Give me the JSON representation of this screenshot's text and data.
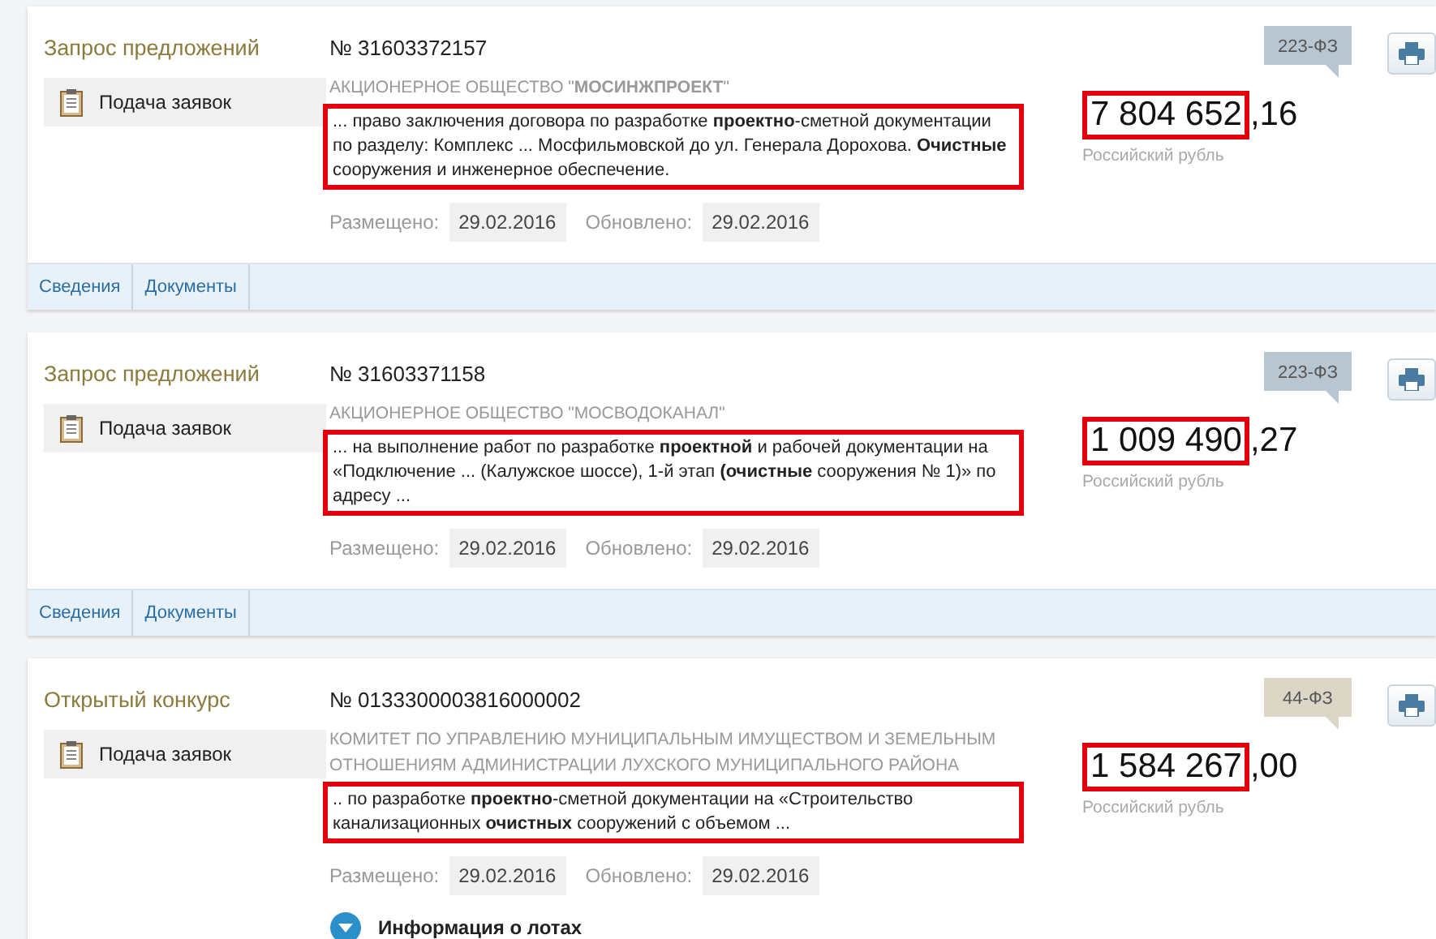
{
  "cards": [
    {
      "category": "Запрос предложений",
      "status": "Подача заявок",
      "number": "№ 31603372157",
      "customer": "АКЦИОНЕРНОЕ ОБЩЕСТВО \"**МОСИНЖПРОЕКТ**\"",
      "description": "... право заключения договора по разработке **проектно**-сметной документации по разделу: Комплекс ... Мосфильмовской до ул. Генерала Дорохова. **Очистные** сооружения и инженерное обеспечение.",
      "price_main": "7 804 652",
      "price_rest": ",16",
      "currency": "Российский рубль",
      "law": "223-ФЗ",
      "color": "#b8c6d2",
      "posted_label": "Размещено:",
      "posted": "29.02.2016",
      "updated_label": "Обновлено:",
      "updated": "29.02.2016",
      "tabs": [
        "Сведения",
        "Документы"
      ]
    },
    {
      "category": "Запрос предложений",
      "status": "Подача заявок",
      "number": "№ 31603371158",
      "customer": "АКЦИОНЕРНОЕ ОБЩЕСТВО \"МОСВОДОКАНАЛ\"",
      "description": "... на выполнение работ по разработке **проектной** и рабочей документации на «Подключение ... (Калужское шоссе), 1-й этап **(очистные** сооружения № 1)» по адресу ...",
      "price_main": "1 009 490",
      "price_rest": ",27",
      "currency": "Российский рубль",
      "law": "223-ФЗ",
      "color": "#b8c6d2",
      "posted_label": "Размещено:",
      "posted": "29.02.2016",
      "updated_label": "Обновлено:",
      "updated": "29.02.2016",
      "tabs": [
        "Сведения",
        "Документы"
      ]
    },
    {
      "category": "Открытый конкурс",
      "status": "Подача заявок",
      "number": "№ 0133300003816000002",
      "customer": "КОМИТЕТ ПО УПРАВЛЕНИЮ МУНИЦИПАЛЬНЫМ ИМУЩЕСТВОМ И ЗЕМЕЛЬНЫМ ОТНОШЕНИЯМ АДМИНИСТРАЦИИ ЛУХСКОГО МУНИЦИПАЛЬНОГО РАЙОНА",
      "description": "..  по разработке **проектно**-сметной документации на «Строительство канализационных **очистных** сооружений с объемом ...",
      "price_main": "1 584 267",
      "price_rest": ",00",
      "currency": "Российский рубль",
      "law": "44-ФЗ",
      "color": "#dcd6c6",
      "posted_label": "Размещено:",
      "posted": "29.02.2016",
      "updated_label": "Обновлено:",
      "updated": "29.02.2016",
      "lots": "Информация о лотах"
    }
  ]
}
